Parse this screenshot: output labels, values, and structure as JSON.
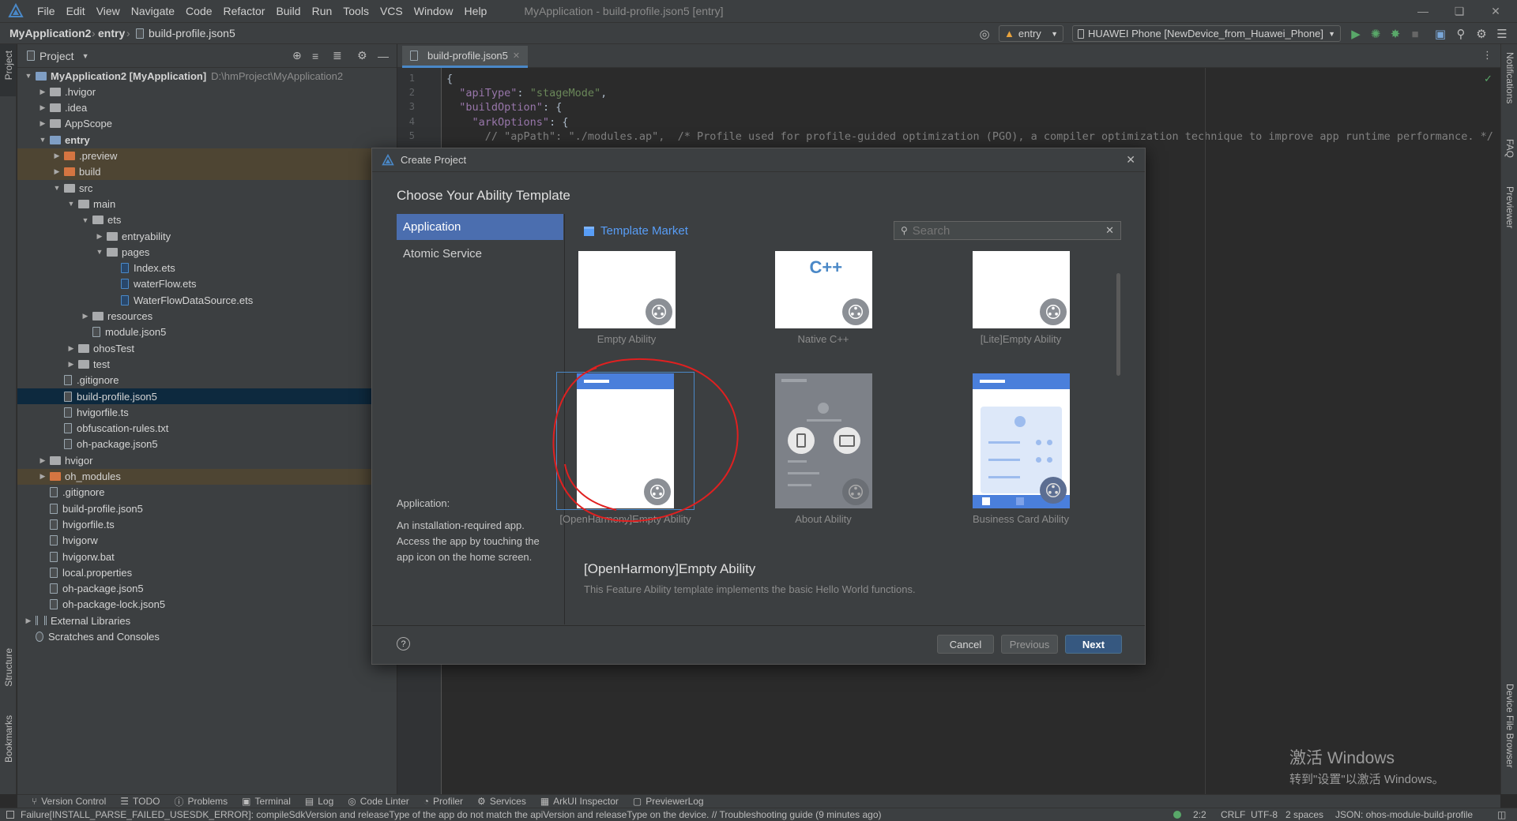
{
  "app": {
    "menu": [
      "File",
      "Edit",
      "View",
      "Navigate",
      "Code",
      "Refactor",
      "Build",
      "Run",
      "Tools",
      "VCS",
      "Window",
      "Help"
    ],
    "window_title": "MyApplication - build-profile.json5 [entry]"
  },
  "breadcrumb": {
    "project": "MyApplication2",
    "module": "entry",
    "file": "build-profile.json5"
  },
  "toolbar": {
    "config": "entry",
    "device": "HUAWEI Phone [NewDevice_from_Huawei_Phone]"
  },
  "side_tabs": {
    "project": "Project",
    "structure": "Structure",
    "bookmarks": "Bookmarks",
    "notifications": "Notifications",
    "faq": "FAQ",
    "previewer": "Previewer",
    "device_file_browser": "Device File Browser"
  },
  "project_panel": {
    "title": "Project",
    "tree": [
      {
        "label": "MyApplication2 [MyApplication]",
        "extra": "D:\\hmProject\\MyApplication2",
        "depth": 0,
        "arrow": "open",
        "icon": "folder-blue",
        "bold": true
      },
      {
        "label": ".hvigor",
        "depth": 1,
        "arrow": "closed",
        "icon": "folder"
      },
      {
        "label": ".idea",
        "depth": 1,
        "arrow": "closed",
        "icon": "folder"
      },
      {
        "label": "AppScope",
        "depth": 1,
        "arrow": "closed",
        "icon": "folder"
      },
      {
        "label": "entry",
        "depth": 1,
        "arrow": "open",
        "icon": "folder-blue",
        "bold": true
      },
      {
        "label": ".preview",
        "depth": 2,
        "arrow": "closed",
        "icon": "folder-orange",
        "hl": true
      },
      {
        "label": "build",
        "depth": 2,
        "arrow": "closed",
        "icon": "folder-orange",
        "hl": true
      },
      {
        "label": "src",
        "depth": 2,
        "arrow": "open",
        "icon": "folder"
      },
      {
        "label": "main",
        "depth": 3,
        "arrow": "open",
        "icon": "folder"
      },
      {
        "label": "ets",
        "depth": 4,
        "arrow": "open",
        "icon": "folder"
      },
      {
        "label": "entryability",
        "depth": 5,
        "arrow": "closed",
        "icon": "folder"
      },
      {
        "label": "pages",
        "depth": 5,
        "arrow": "open",
        "icon": "folder"
      },
      {
        "label": "Index.ets",
        "depth": 6,
        "arrow": "",
        "icon": "file-ets"
      },
      {
        "label": "waterFlow.ets",
        "depth": 6,
        "arrow": "",
        "icon": "file-ets"
      },
      {
        "label": "WaterFlowDataSource.ets",
        "depth": 6,
        "arrow": "",
        "icon": "file-ets"
      },
      {
        "label": "resources",
        "depth": 4,
        "arrow": "closed",
        "icon": "folder"
      },
      {
        "label": "module.json5",
        "depth": 4,
        "arrow": "",
        "icon": "file"
      },
      {
        "label": "ohosTest",
        "depth": 3,
        "arrow": "closed",
        "icon": "folder"
      },
      {
        "label": "test",
        "depth": 3,
        "arrow": "closed",
        "icon": "folder"
      },
      {
        "label": ".gitignore",
        "depth": 2,
        "arrow": "",
        "icon": "file"
      },
      {
        "label": "build-profile.json5",
        "depth": 2,
        "arrow": "",
        "icon": "file",
        "sel": true
      },
      {
        "label": "hvigorfile.ts",
        "depth": 2,
        "arrow": "",
        "icon": "file"
      },
      {
        "label": "obfuscation-rules.txt",
        "depth": 2,
        "arrow": "",
        "icon": "file"
      },
      {
        "label": "oh-package.json5",
        "depth": 2,
        "arrow": "",
        "icon": "file"
      },
      {
        "label": "hvigor",
        "depth": 1,
        "arrow": "closed",
        "icon": "folder"
      },
      {
        "label": "oh_modules",
        "depth": 1,
        "arrow": "closed",
        "icon": "folder-orange",
        "hl": true
      },
      {
        "label": ".gitignore",
        "depth": 1,
        "arrow": "",
        "icon": "file"
      },
      {
        "label": "build-profile.json5",
        "depth": 1,
        "arrow": "",
        "icon": "file"
      },
      {
        "label": "hvigorfile.ts",
        "depth": 1,
        "arrow": "",
        "icon": "file"
      },
      {
        "label": "hvigorw",
        "depth": 1,
        "arrow": "",
        "icon": "file"
      },
      {
        "label": "hvigorw.bat",
        "depth": 1,
        "arrow": "",
        "icon": "file"
      },
      {
        "label": "local.properties",
        "depth": 1,
        "arrow": "",
        "icon": "file"
      },
      {
        "label": "oh-package.json5",
        "depth": 1,
        "arrow": "",
        "icon": "file"
      },
      {
        "label": "oh-package-lock.json5",
        "depth": 1,
        "arrow": "",
        "icon": "file"
      },
      {
        "label": "External Libraries",
        "depth": 0,
        "arrow": "closed",
        "icon": "lib"
      },
      {
        "label": "Scratches and Consoles",
        "depth": 0,
        "arrow": "",
        "icon": "scratch"
      }
    ]
  },
  "editor": {
    "tab": "build-profile.json5",
    "lines": [
      {
        "n": "1",
        "html": "{"
      },
      {
        "n": "2",
        "html": "  <span class=\"k\">\"apiType\"</span>: <span class=\"s\">\"stageMode\"</span>,"
      },
      {
        "n": "3",
        "html": "  <span class=\"k\">\"buildOption\"</span>: {"
      },
      {
        "n": "4",
        "html": "    <span class=\"k\">\"arkOptions\"</span>: {"
      },
      {
        "n": "5",
        "html": "      <span class=\"c\">// \"apPath\": \"./modules.ap\",  /* Profile used for profile-guided optimization (PGO), a compiler optimization technique to improve app runtime performance. */</span>"
      }
    ]
  },
  "dialog": {
    "title": "Create Project",
    "heading": "Choose Your Ability Template",
    "categories": [
      "Application",
      "Atomic Service"
    ],
    "category_desc_title": "Application:",
    "category_desc": "An installation-required app. Access the app by touching the app icon on the home screen.",
    "template_market": "Template Market",
    "search_placeholder": "Search",
    "templates": [
      "Empty Ability",
      "Native C++",
      "[Lite]Empty Ability",
      "[OpenHarmony]Empty Ability",
      "About Ability",
      "Business Card Ability"
    ],
    "selected_title": "[OpenHarmony]Empty Ability",
    "selected_desc": "This Feature Ability template implements the basic Hello World functions.",
    "cancel": "Cancel",
    "previous": "Previous",
    "next": "Next",
    "native_logo": "C++"
  },
  "bottom_tools": [
    "Version Control",
    "TODO",
    "Problems",
    "Terminal",
    "Log",
    "Code Linter",
    "Profiler",
    "Services",
    "ArkUI Inspector",
    "PreviewerLog"
  ],
  "status": {
    "message": "Failure[INSTALL_PARSE_FAILED_USESDK_ERROR]: compileSdkVersion and releaseType of the app do not match the apiVersion and releaseType on the device. // Troubleshooting guide (9 minutes ago)",
    "position": "2:2",
    "line_sep": "CRLF",
    "encoding": "UTF-8",
    "indent": "2 spaces",
    "schema": "JSON: ohos-module-build-profile"
  },
  "watermark": {
    "line1": "激活 Windows",
    "line2": "转到\"设置\"以激活 Windows。"
  },
  "colors": {
    "accent": "#4b6eaf",
    "link": "#589df6",
    "selection_box": "#4a88c7",
    "annotation": "#e02020"
  }
}
